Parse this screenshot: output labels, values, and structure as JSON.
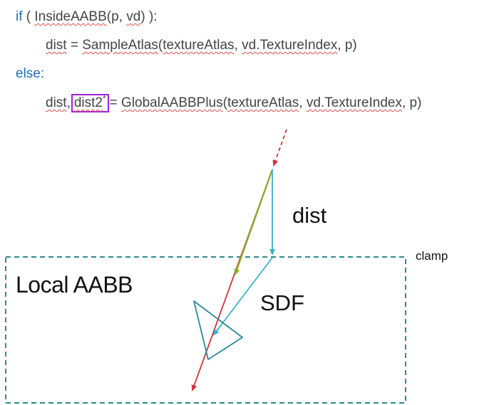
{
  "code": {
    "line1": {
      "kw_if": "if",
      "open": " ( ",
      "fn": "InsideAABB",
      "args_open": "(",
      "a1": "p",
      "sep": ", ",
      "a2": "vd",
      "close": ") ):"
    },
    "line2": {
      "var": "dist",
      "eq": " = ",
      "fn": "SampleAtlas",
      "args": "(",
      "a1": "textureAtlas",
      "sep1": ", ",
      "a2": "vd.TextureIndex",
      "tail": ", p)"
    },
    "line3": {
      "kw_else": "else:"
    },
    "line4": {
      "var1": "dist",
      "comma": ",",
      "var2": "dist2",
      "star": "*",
      "eq": "= ",
      "fn": "GlobalAABBPlus",
      "args": "(",
      "a1": "textureAtlas",
      "sep1": ", ",
      "a2": "vd.TextureIndex",
      "tail": ", p)"
    }
  },
  "labels": {
    "dist": "dist",
    "clamp": "clamp",
    "local_aabb": "Local AABB",
    "sdf": "SDF"
  },
  "colors": {
    "keyword": "#1f6fb8",
    "highlight_box": "#a11ee0",
    "aabb_box": "#2e8b8b",
    "ray": "#d0343c",
    "step": "#8aa828",
    "dist_arrow": "#3bb3cc",
    "triangle": "#2a8a96"
  }
}
